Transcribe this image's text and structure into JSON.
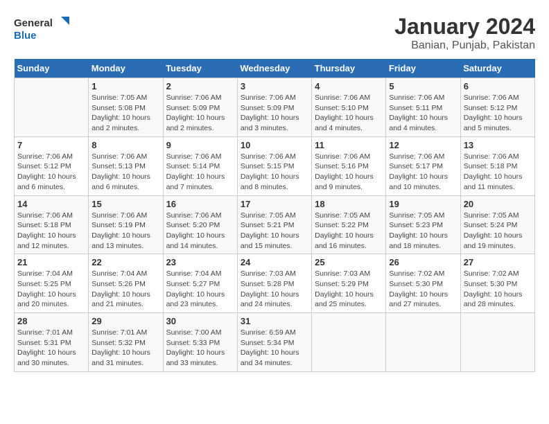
{
  "logo": {
    "general": "General",
    "blue": "Blue"
  },
  "title": "January 2024",
  "subtitle": "Banian, Punjab, Pakistan",
  "weekdays": [
    "Sunday",
    "Monday",
    "Tuesday",
    "Wednesday",
    "Thursday",
    "Friday",
    "Saturday"
  ],
  "weeks": [
    [
      {
        "day": "",
        "info": ""
      },
      {
        "day": "1",
        "info": "Sunrise: 7:05 AM\nSunset: 5:08 PM\nDaylight: 10 hours\nand 2 minutes."
      },
      {
        "day": "2",
        "info": "Sunrise: 7:06 AM\nSunset: 5:09 PM\nDaylight: 10 hours\nand 2 minutes."
      },
      {
        "day": "3",
        "info": "Sunrise: 7:06 AM\nSunset: 5:09 PM\nDaylight: 10 hours\nand 3 minutes."
      },
      {
        "day": "4",
        "info": "Sunrise: 7:06 AM\nSunset: 5:10 PM\nDaylight: 10 hours\nand 4 minutes."
      },
      {
        "day": "5",
        "info": "Sunrise: 7:06 AM\nSunset: 5:11 PM\nDaylight: 10 hours\nand 4 minutes."
      },
      {
        "day": "6",
        "info": "Sunrise: 7:06 AM\nSunset: 5:12 PM\nDaylight: 10 hours\nand 5 minutes."
      }
    ],
    [
      {
        "day": "7",
        "info": "Sunrise: 7:06 AM\nSunset: 5:12 PM\nDaylight: 10 hours\nand 6 minutes."
      },
      {
        "day": "8",
        "info": "Sunrise: 7:06 AM\nSunset: 5:13 PM\nDaylight: 10 hours\nand 6 minutes."
      },
      {
        "day": "9",
        "info": "Sunrise: 7:06 AM\nSunset: 5:14 PM\nDaylight: 10 hours\nand 7 minutes."
      },
      {
        "day": "10",
        "info": "Sunrise: 7:06 AM\nSunset: 5:15 PM\nDaylight: 10 hours\nand 8 minutes."
      },
      {
        "day": "11",
        "info": "Sunrise: 7:06 AM\nSunset: 5:16 PM\nDaylight: 10 hours\nand 9 minutes."
      },
      {
        "day": "12",
        "info": "Sunrise: 7:06 AM\nSunset: 5:17 PM\nDaylight: 10 hours\nand 10 minutes."
      },
      {
        "day": "13",
        "info": "Sunrise: 7:06 AM\nSunset: 5:18 PM\nDaylight: 10 hours\nand 11 minutes."
      }
    ],
    [
      {
        "day": "14",
        "info": "Sunrise: 7:06 AM\nSunset: 5:18 PM\nDaylight: 10 hours\nand 12 minutes."
      },
      {
        "day": "15",
        "info": "Sunrise: 7:06 AM\nSunset: 5:19 PM\nDaylight: 10 hours\nand 13 minutes."
      },
      {
        "day": "16",
        "info": "Sunrise: 7:06 AM\nSunset: 5:20 PM\nDaylight: 10 hours\nand 14 minutes."
      },
      {
        "day": "17",
        "info": "Sunrise: 7:05 AM\nSunset: 5:21 PM\nDaylight: 10 hours\nand 15 minutes."
      },
      {
        "day": "18",
        "info": "Sunrise: 7:05 AM\nSunset: 5:22 PM\nDaylight: 10 hours\nand 16 minutes."
      },
      {
        "day": "19",
        "info": "Sunrise: 7:05 AM\nSunset: 5:23 PM\nDaylight: 10 hours\nand 18 minutes."
      },
      {
        "day": "20",
        "info": "Sunrise: 7:05 AM\nSunset: 5:24 PM\nDaylight: 10 hours\nand 19 minutes."
      }
    ],
    [
      {
        "day": "21",
        "info": "Sunrise: 7:04 AM\nSunset: 5:25 PM\nDaylight: 10 hours\nand 20 minutes."
      },
      {
        "day": "22",
        "info": "Sunrise: 7:04 AM\nSunset: 5:26 PM\nDaylight: 10 hours\nand 21 minutes."
      },
      {
        "day": "23",
        "info": "Sunrise: 7:04 AM\nSunset: 5:27 PM\nDaylight: 10 hours\nand 23 minutes."
      },
      {
        "day": "24",
        "info": "Sunrise: 7:03 AM\nSunset: 5:28 PM\nDaylight: 10 hours\nand 24 minutes."
      },
      {
        "day": "25",
        "info": "Sunrise: 7:03 AM\nSunset: 5:29 PM\nDaylight: 10 hours\nand 25 minutes."
      },
      {
        "day": "26",
        "info": "Sunrise: 7:02 AM\nSunset: 5:30 PM\nDaylight: 10 hours\nand 27 minutes."
      },
      {
        "day": "27",
        "info": "Sunrise: 7:02 AM\nSunset: 5:30 PM\nDaylight: 10 hours\nand 28 minutes."
      }
    ],
    [
      {
        "day": "28",
        "info": "Sunrise: 7:01 AM\nSunset: 5:31 PM\nDaylight: 10 hours\nand 30 minutes."
      },
      {
        "day": "29",
        "info": "Sunrise: 7:01 AM\nSunset: 5:32 PM\nDaylight: 10 hours\nand 31 minutes."
      },
      {
        "day": "30",
        "info": "Sunrise: 7:00 AM\nSunset: 5:33 PM\nDaylight: 10 hours\nand 33 minutes."
      },
      {
        "day": "31",
        "info": "Sunrise: 6:59 AM\nSunset: 5:34 PM\nDaylight: 10 hours\nand 34 minutes."
      },
      {
        "day": "",
        "info": ""
      },
      {
        "day": "",
        "info": ""
      },
      {
        "day": "",
        "info": ""
      }
    ]
  ]
}
